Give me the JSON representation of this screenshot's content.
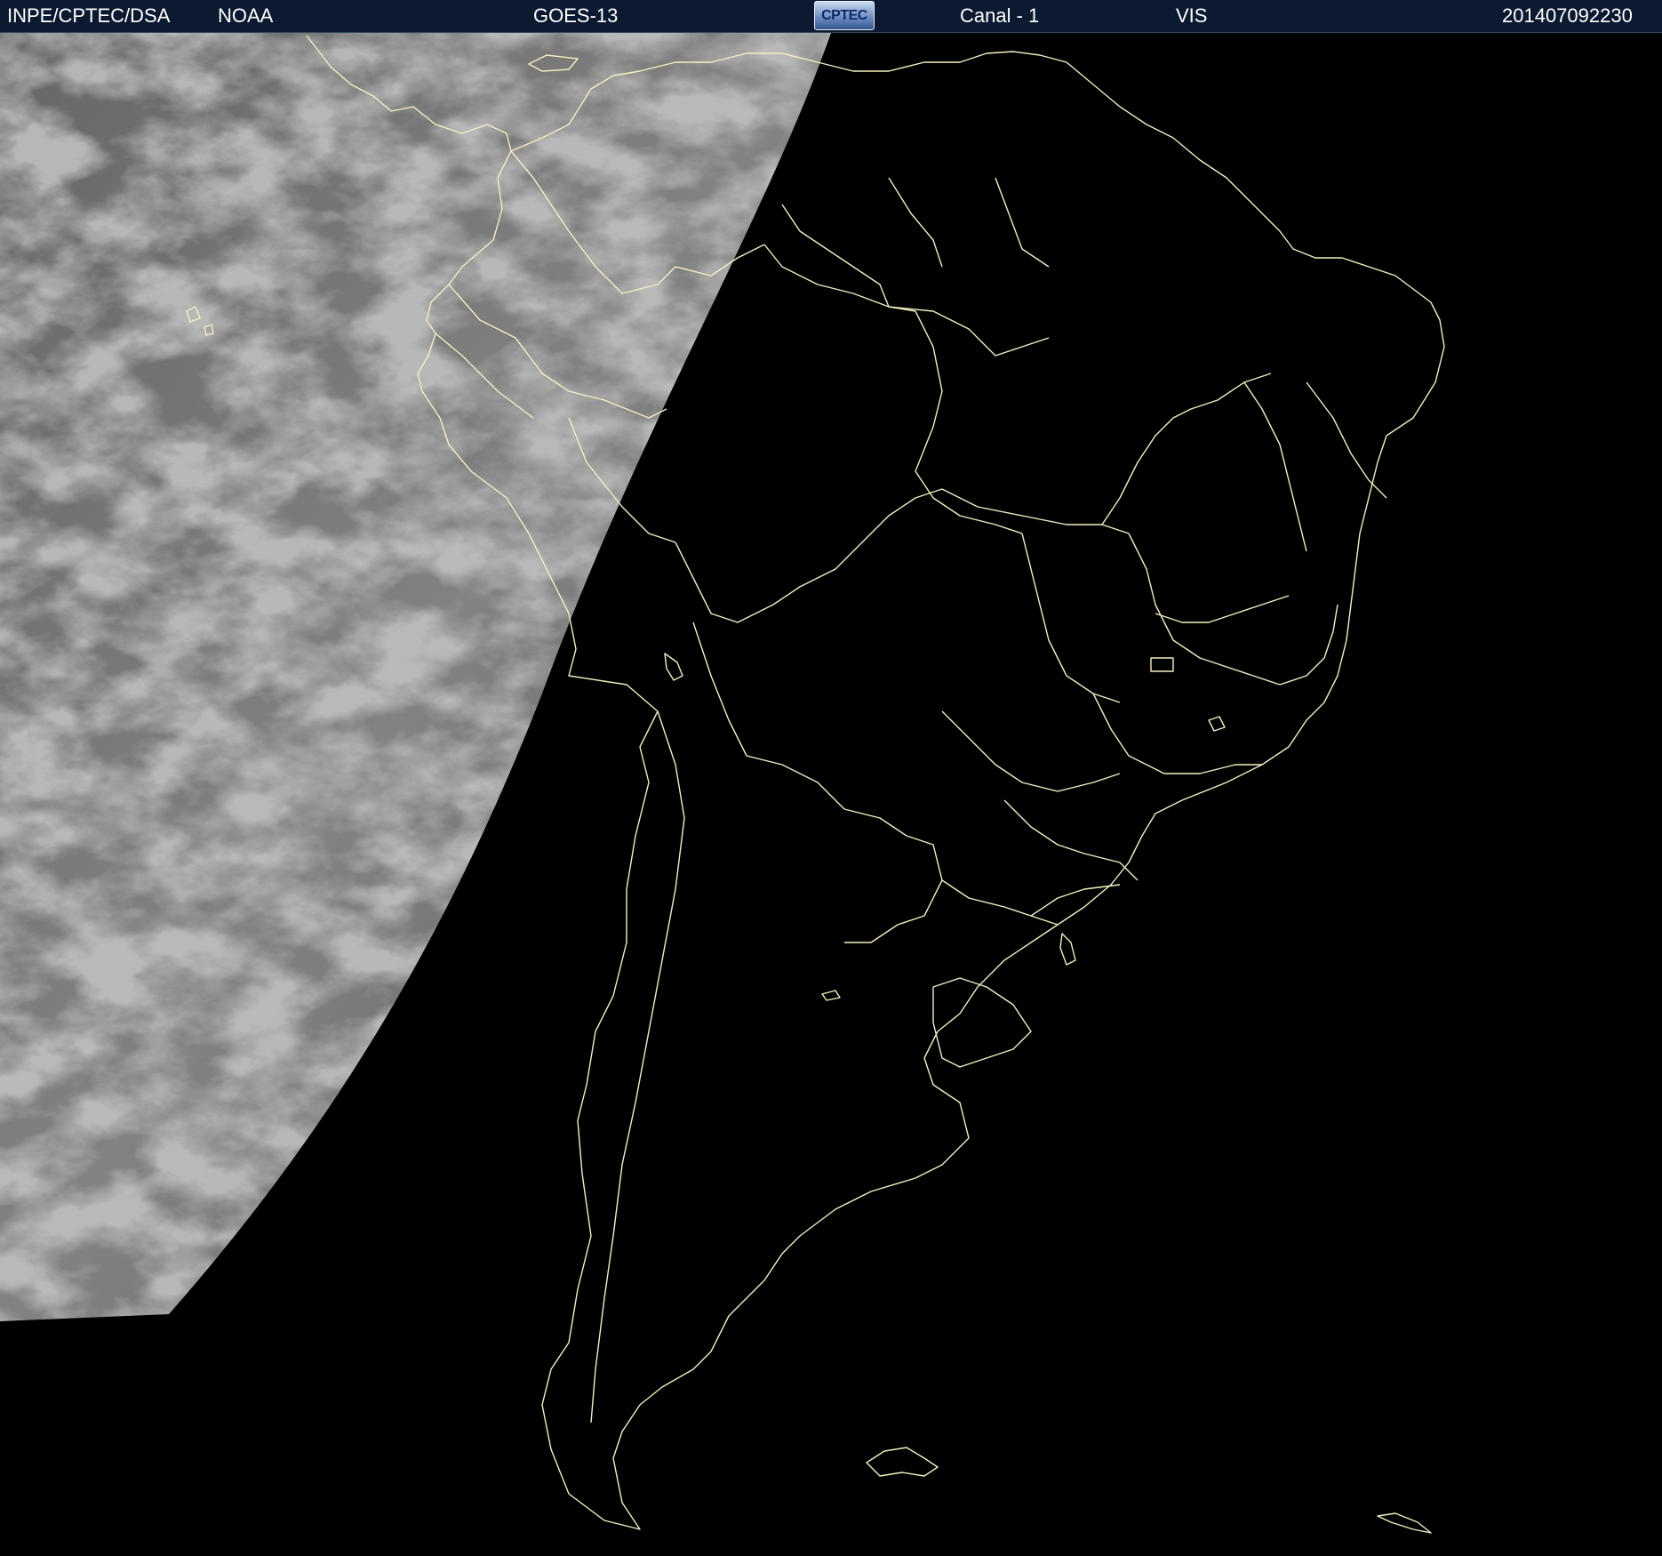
{
  "header": {
    "institution": "INPE/CPTEC/DSA",
    "agency": "NOAA",
    "satellite": "GOES-13",
    "logo_text": "CPTEC",
    "channel": "Canal - 1",
    "band": "VIS",
    "timestamp": "201407092230"
  },
  "colors": {
    "header_bg": "#0b1a30",
    "boundary": "#f4f0c0",
    "night_side": "#000000",
    "day_side": "#7a7a7a"
  },
  "icons": {
    "logo": "cptec-logo"
  }
}
